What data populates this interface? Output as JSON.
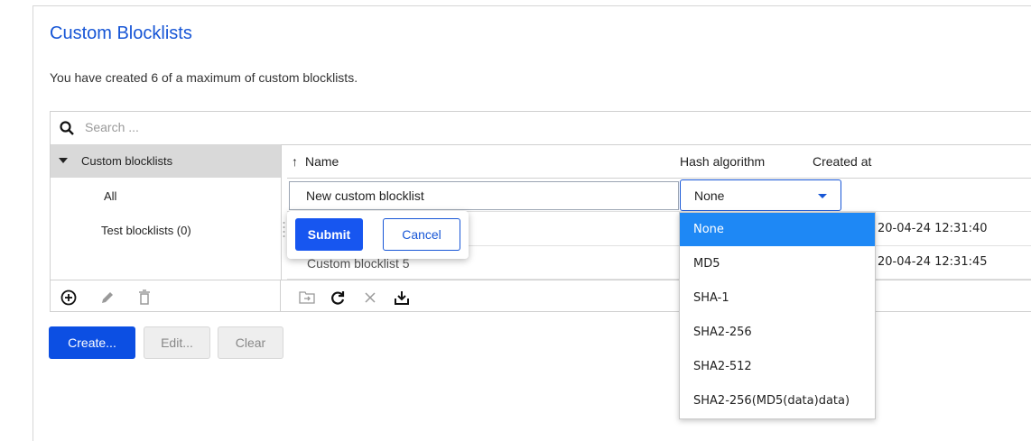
{
  "page": {
    "title": "Custom Blocklists",
    "subtitle": "You have created 6 of a maximum of custom blocklists."
  },
  "search": {
    "placeholder": "Search ..."
  },
  "tree": {
    "root_label": "Custom blocklists",
    "items": [
      "All",
      "Test blocklists (0)"
    ]
  },
  "tree_toolbar": {
    "icons": [
      "add-circle-icon",
      "pencil-icon",
      "trash-icon"
    ]
  },
  "grid": {
    "columns": {
      "name": "Name",
      "hash": "Hash algorithm",
      "created": "Created at"
    },
    "sort_indicator": "↑",
    "edit_row": {
      "name_value": "New custom blocklist",
      "hash_value": "None"
    },
    "rows": [
      {
        "created": "20-04-24 12:31:40"
      },
      {
        "name": "Custom blocklist 5",
        "created": "20-04-24 12:31:45"
      }
    ]
  },
  "grid_toolbar": {
    "icons": [
      "folder-import-icon",
      "refresh-icon",
      "close-icon",
      "download-icon"
    ]
  },
  "popup": {
    "submit": "Submit",
    "cancel": "Cancel"
  },
  "hash_options": [
    "None",
    "MD5",
    "SHA-1",
    "SHA2-256",
    "SHA2-512",
    "SHA2-256(MD5(data)data)"
  ],
  "selected_hash_option": "None",
  "buttons": {
    "create": "Create...",
    "edit": "Edit...",
    "clear": "Clear"
  },
  "colors": {
    "accent": "#1756d6",
    "selected_option": "#1e88f5",
    "tree_header": "#d9d9d9"
  }
}
